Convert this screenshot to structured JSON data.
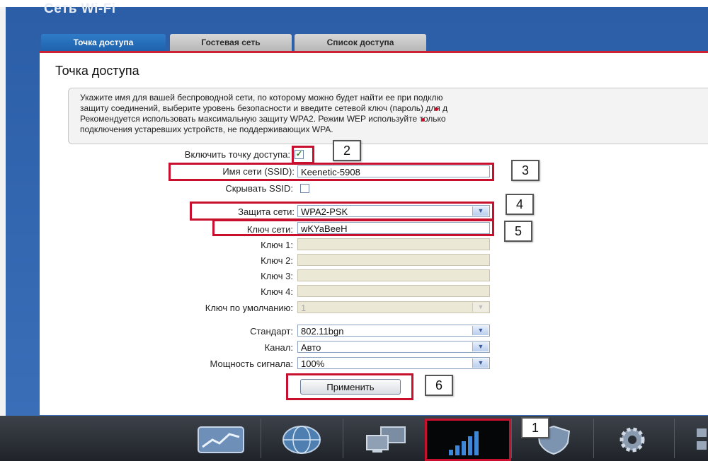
{
  "window": {
    "title": "Сеть Wi-Fi"
  },
  "tabs": [
    {
      "label": "Точка доступа",
      "active": true
    },
    {
      "label": "Гостевая сеть",
      "active": false
    },
    {
      "label": "Список доступа",
      "active": false
    }
  ],
  "section": {
    "title": "Точка доступа"
  },
  "info": {
    "lines": [
      "Укажите имя для вашей беспроводной сети, по которому можно будет найти ее при подклю",
      "защиту соединений, выберите уровень безопасности и введите сетевой ключ (пароль) для д",
      "Рекомендуется использовать максимальную защиту WPA2. Режим WEP используйте только",
      "подключения устаревших устройств, не поддерживающих WPA."
    ]
  },
  "form": {
    "enable_ap": {
      "label": "Включить точку доступа:",
      "checked": true
    },
    "ssid": {
      "label": "Имя сети (SSID):",
      "value": "Keenetic-5908"
    },
    "hide_ssid": {
      "label": "Скрывать SSID:",
      "checked": false
    },
    "security": {
      "label": "Защита сети:",
      "value": "WPA2-PSK"
    },
    "network_key": {
      "label": "Ключ сети:",
      "value": "wKYaBeeH"
    },
    "key1": {
      "label": "Ключ 1:",
      "value": ""
    },
    "key2": {
      "label": "Ключ 2:",
      "value": ""
    },
    "key3": {
      "label": "Ключ 3:",
      "value": ""
    },
    "key4": {
      "label": "Ключ 4:",
      "value": ""
    },
    "default_key": {
      "label": "Ключ по умолчанию:",
      "value": "1"
    },
    "standard": {
      "label": "Стандарт:",
      "value": "802.11bgn"
    },
    "channel": {
      "label": "Канал:",
      "value": "Авто"
    },
    "power": {
      "label": "Мощность сигнала:",
      "value": "100%"
    },
    "apply_label": "Применить"
  },
  "annotations": {
    "n1": "1",
    "n2": "2",
    "n3": "3",
    "n4": "4",
    "n5": "5",
    "n6": "6"
  },
  "taskbar": {
    "icons": [
      "monitor-chart-icon",
      "globe-icon",
      "network-computers-icon",
      "wifi-signal-icon",
      "shield-icon",
      "gear-icon"
    ],
    "active": "wifi-signal-icon"
  },
  "colors": {
    "accent": "#2f7cc8",
    "highlight": "#c8102e",
    "background": "#2b5ea7"
  }
}
